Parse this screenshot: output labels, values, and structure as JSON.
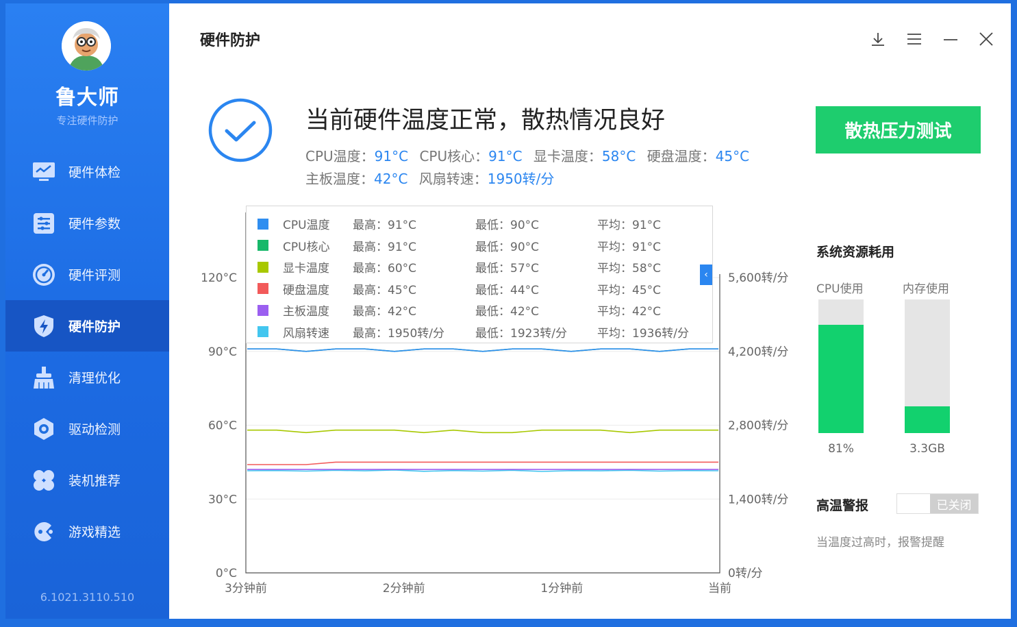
{
  "app": {
    "name": "鲁大师",
    "subtitle": "专注硬件防护",
    "version": "6.1021.3110.510"
  },
  "nav": {
    "items": [
      {
        "label": "硬件体检",
        "icon": "monitor-check-icon"
      },
      {
        "label": "硬件参数",
        "icon": "sliders-list-icon"
      },
      {
        "label": "硬件评测",
        "icon": "speedometer-icon"
      },
      {
        "label": "硬件防护",
        "icon": "shield-bolt-icon",
        "active": true
      },
      {
        "label": "清理优化",
        "icon": "broom-icon"
      },
      {
        "label": "驱动检测",
        "icon": "gear-hex-icon"
      },
      {
        "label": "装机推荐",
        "icon": "four-petal-icon"
      },
      {
        "label": "游戏精选",
        "icon": "gamepad-icon"
      }
    ]
  },
  "header": {
    "title": "硬件防护"
  },
  "window_controls": [
    "download-icon",
    "menu-icon",
    "minimize-icon",
    "close-icon"
  ],
  "status": {
    "title": "当前硬件温度正常，散热情况良好",
    "line1": [
      {
        "label": "CPU温度：",
        "value": "91°C"
      },
      {
        "label": "CPU核心：",
        "value": "91°C"
      },
      {
        "label": "显卡温度：",
        "value": "58°C"
      },
      {
        "label": "硬盘温度：",
        "value": "45°C"
      }
    ],
    "line2": [
      {
        "label": "主板温度：",
        "value": "42°C"
      },
      {
        "label": "风扇转速：",
        "value": "1950转/分"
      }
    ]
  },
  "stress_button": "散热压力测试",
  "legend": {
    "rows": [
      {
        "name": "CPU温度",
        "color": "#2f8ef0",
        "max": "最高：91°C",
        "min": "最低：90°C",
        "avg": "平均：91°C"
      },
      {
        "name": "CPU核心",
        "color": "#18b86a",
        "max": "最高：91°C",
        "min": "最低：90°C",
        "avg": "平均：91°C"
      },
      {
        "name": "显卡温度",
        "color": "#a8c800",
        "max": "最高：60°C",
        "min": "最低：57°C",
        "avg": "平均：58°C"
      },
      {
        "name": "硬盘温度",
        "color": "#f25a5a",
        "max": "最高：45°C",
        "min": "最低：44°C",
        "avg": "平均：45°C"
      },
      {
        "name": "主板温度",
        "color": "#9b5ff0",
        "max": "最高：42°C",
        "min": "最低：42°C",
        "avg": "平均：42°C"
      },
      {
        "name": "风扇转速",
        "color": "#43c6ef",
        "max": "最高：1950转/分",
        "min": "最低：1923转/分",
        "avg": "平均：1936转/分"
      }
    ]
  },
  "chart_data": {
    "type": "line",
    "x": [
      "3分钟前",
      "2分钟前",
      "1分钟前",
      "当前"
    ],
    "y_left": {
      "ticks": [
        "0°C",
        "30°C",
        "60°C",
        "90°C",
        "120°C"
      ],
      "range": [
        0,
        120
      ]
    },
    "y_right": {
      "ticks": [
        "0转/分",
        "1,400转/分",
        "2,800转/分",
        "4,200转/分",
        "5,600转/分"
      ],
      "range": [
        0,
        5600
      ]
    },
    "grid": true,
    "series": [
      {
        "name": "CPU温度",
        "axis": "left",
        "color": "#2f8ef0",
        "values": [
          91,
          91,
          90,
          91,
          91,
          90,
          91,
          91,
          90,
          91,
          91,
          90,
          91,
          91,
          90,
          91,
          91
        ]
      },
      {
        "name": "CPU核心",
        "axis": "left",
        "color": "#18b86a",
        "values": [
          91,
          91,
          90,
          91,
          91,
          90,
          91,
          91,
          90,
          91,
          91,
          90,
          91,
          91,
          90,
          91,
          91
        ]
      },
      {
        "name": "显卡温度",
        "axis": "left",
        "color": "#a8c800",
        "values": [
          58,
          58,
          57,
          58,
          58,
          58,
          57,
          58,
          57,
          57,
          58,
          58,
          58,
          57,
          58,
          58,
          58
        ]
      },
      {
        "name": "硬盘温度",
        "axis": "left",
        "color": "#f25a5a",
        "values": [
          44,
          44,
          44,
          45,
          45,
          45,
          45,
          45,
          45,
          45,
          45,
          45,
          45,
          45,
          45,
          45,
          45
        ]
      },
      {
        "name": "主板温度",
        "axis": "left",
        "color": "#9b5ff0",
        "values": [
          42,
          42,
          42,
          42,
          42,
          42,
          42,
          42,
          42,
          42,
          42,
          42,
          42,
          42,
          42,
          42,
          42
        ]
      },
      {
        "name": "风扇转速",
        "axis": "right",
        "color": "#43c6ef",
        "values": [
          1936,
          1940,
          1930,
          1945,
          1935,
          1950,
          1925,
          1940,
          1930,
          1945,
          1923,
          1938,
          1935,
          1945,
          1930,
          1940,
          1936
        ]
      }
    ]
  },
  "resources": {
    "title": "系统资源耗用",
    "cpu": {
      "label": "CPU使用",
      "value": "81%",
      "fraction": 0.81
    },
    "mem": {
      "label": "内存使用",
      "value": "3.3GB",
      "fraction": 0.2
    },
    "bar_color": "#12d16e"
  },
  "alarm": {
    "title": "高温警报",
    "toggle_label": "已关闭",
    "hint": "当温度过高时，报警提醒"
  }
}
